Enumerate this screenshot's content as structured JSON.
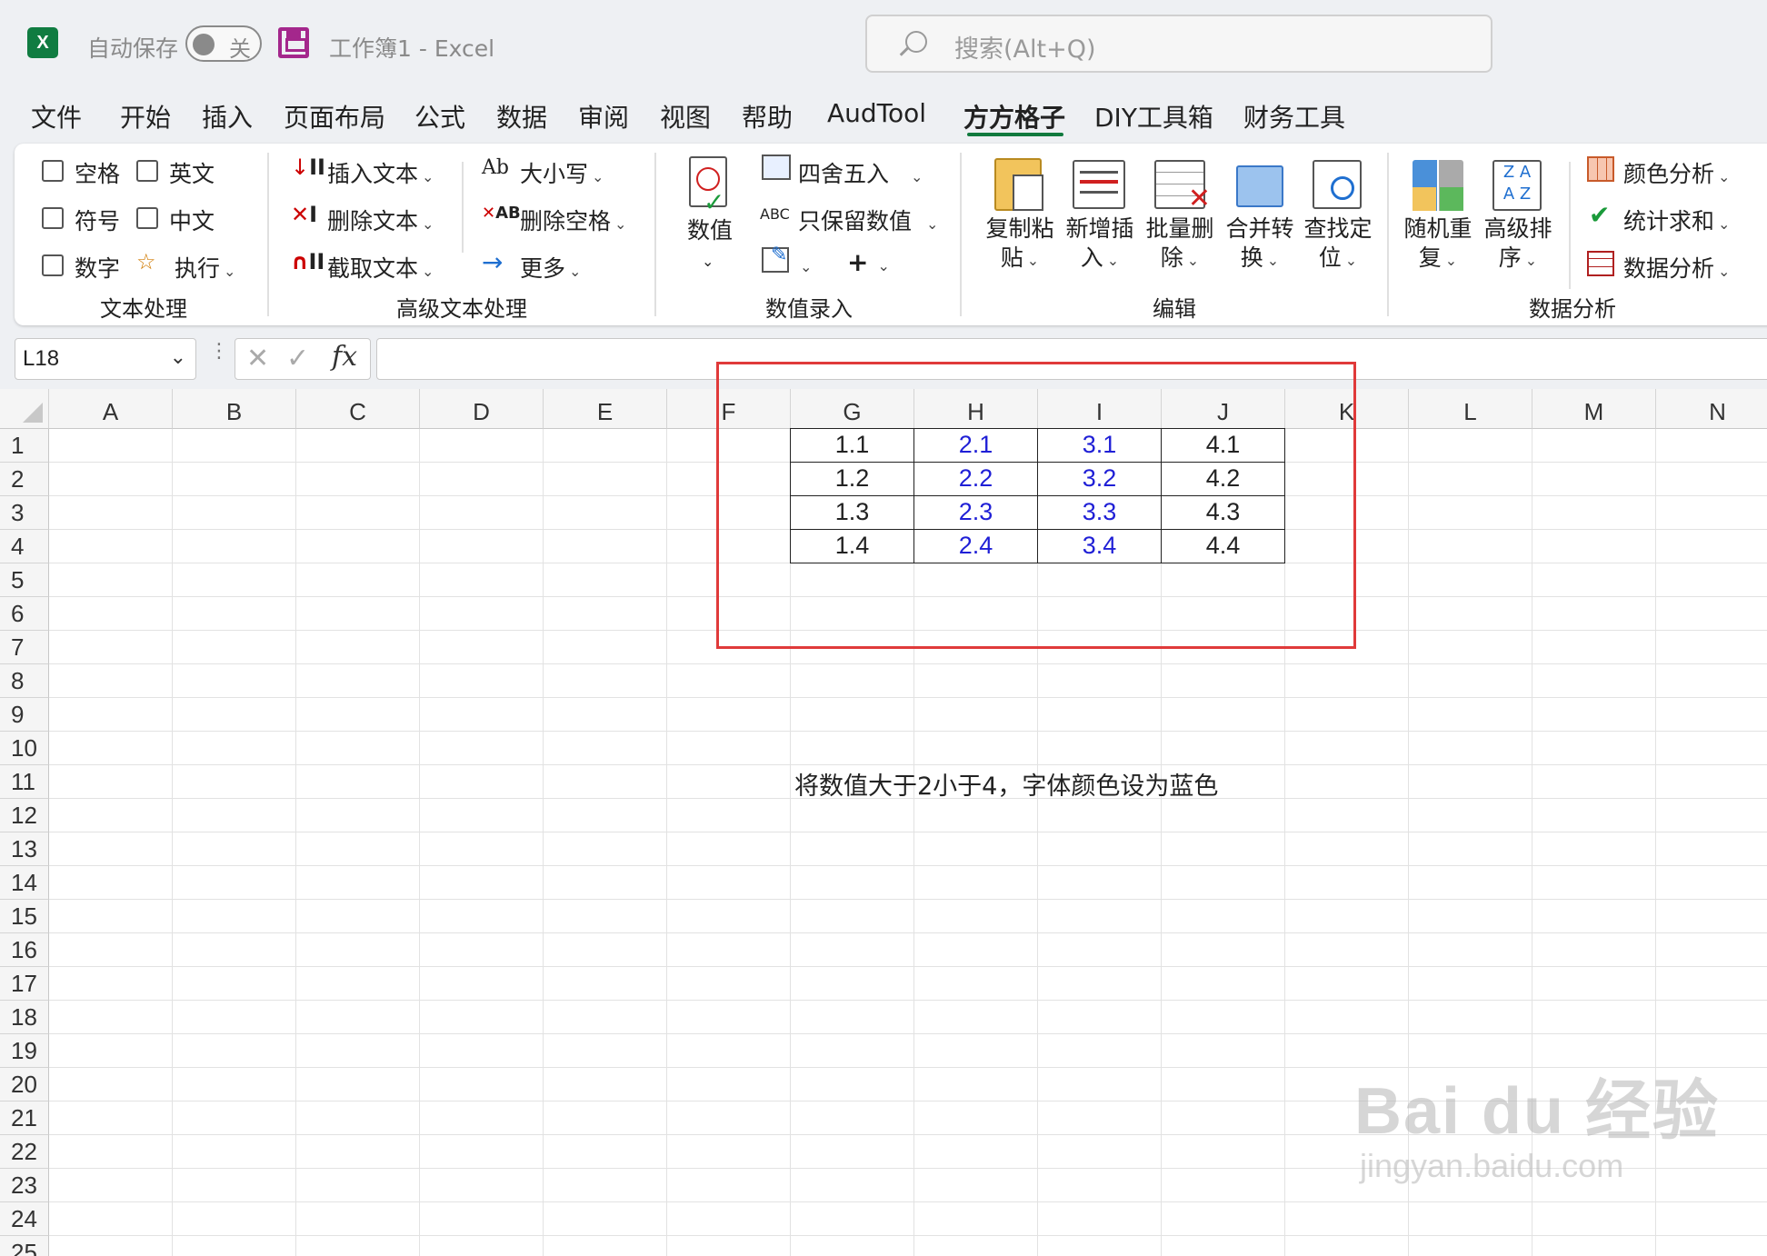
{
  "titlebar": {
    "app_icon": "excel-logo-icon",
    "app_icon_letter": "X",
    "autosave_label": "自动保存",
    "autosave_state": "关",
    "doc_title": "工作簿1  -  Excel",
    "search_placeholder": "搜索(Alt+Q)"
  },
  "menu": {
    "items": [
      "文件",
      "开始",
      "插入",
      "页面布局",
      "公式",
      "数据",
      "审阅",
      "视图",
      "帮助",
      "AudTool",
      "方方格子",
      "DIY工具箱",
      "财务工具"
    ],
    "active": "方方格子"
  },
  "ribbon": {
    "text_group": {
      "label": "文本处理",
      "checks": [
        "空格",
        "英文",
        "符号",
        "中文",
        "数字"
      ],
      "execute": "执行"
    },
    "adv_text_group": {
      "label": "高级文本处理",
      "insert_text": "插入文本",
      "delete_text": "删除文本",
      "extract_text": "截取文本",
      "case": "大小写",
      "case_icon_text": "Ab",
      "delete_space": "删除空格",
      "delete_space_icon_text": "AB",
      "more": "更多"
    },
    "number_group": {
      "label": "数值录入",
      "value": "数值",
      "round": "四舍五入",
      "keep_value": "只保留数值",
      "keep_value_icon_text": "ABC",
      "plus": "+"
    },
    "edit_group": {
      "label": "编辑",
      "copy_paste": [
        "复制粘",
        "贴"
      ],
      "new_insert": [
        "新增插",
        "入"
      ],
      "batch_delete": [
        "批量删",
        "除"
      ],
      "merge_convert": [
        "合并转",
        "换"
      ],
      "find_locate": [
        "查找定",
        "位"
      ]
    },
    "analysis_group": {
      "label": "数据分析",
      "random_repeat": [
        "随机重",
        "复"
      ],
      "adv_sort": [
        "高级排",
        "序"
      ],
      "color_analysis": "颜色分析",
      "stat_sum": "统计求和",
      "data_analysis": "数据分析"
    }
  },
  "formula_bar": {
    "name_box": "L18",
    "fx": "fx",
    "formula": ""
  },
  "sheet": {
    "columns": [
      "A",
      "B",
      "C",
      "D",
      "E",
      "F",
      "G",
      "H",
      "I",
      "J",
      "K",
      "L",
      "M",
      "N"
    ],
    "rows": [
      "1",
      "2",
      "3",
      "4",
      "5",
      "6",
      "7",
      "8",
      "9",
      "10",
      "11",
      "12",
      "13",
      "14",
      "15",
      "16",
      "17",
      "18",
      "19",
      "20",
      "21",
      "22",
      "23",
      "24",
      "25"
    ],
    "table": [
      [
        "1.1",
        "2.1",
        "3.1",
        "4.1"
      ],
      [
        "1.2",
        "2.2",
        "3.2",
        "4.2"
      ],
      [
        "1.3",
        "2.3",
        "3.3",
        "4.3"
      ],
      [
        "1.4",
        "2.4",
        "3.4",
        "4.4"
      ]
    ],
    "note": "将数值大于2小于4，字体颜色设为蓝色",
    "blue_color": "#1f1fd6",
    "highlight_color": "#e03a3a"
  },
  "watermark": {
    "big": "Bai du 经验",
    "small": "jingyan.baidu.com"
  }
}
